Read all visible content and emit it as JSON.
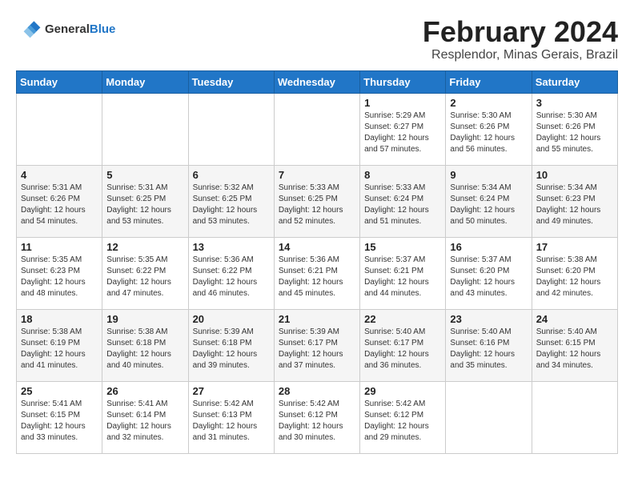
{
  "header": {
    "logo_general": "General",
    "logo_blue": "Blue",
    "month_year": "February 2024",
    "location": "Resplendor, Minas Gerais, Brazil"
  },
  "days_of_week": [
    "Sunday",
    "Monday",
    "Tuesday",
    "Wednesday",
    "Thursday",
    "Friday",
    "Saturday"
  ],
  "weeks": [
    [
      {
        "day": "",
        "info": ""
      },
      {
        "day": "",
        "info": ""
      },
      {
        "day": "",
        "info": ""
      },
      {
        "day": "",
        "info": ""
      },
      {
        "day": "1",
        "info": "Sunrise: 5:29 AM\nSunset: 6:27 PM\nDaylight: 12 hours\nand 57 minutes."
      },
      {
        "day": "2",
        "info": "Sunrise: 5:30 AM\nSunset: 6:26 PM\nDaylight: 12 hours\nand 56 minutes."
      },
      {
        "day": "3",
        "info": "Sunrise: 5:30 AM\nSunset: 6:26 PM\nDaylight: 12 hours\nand 55 minutes."
      }
    ],
    [
      {
        "day": "4",
        "info": "Sunrise: 5:31 AM\nSunset: 6:26 PM\nDaylight: 12 hours\nand 54 minutes."
      },
      {
        "day": "5",
        "info": "Sunrise: 5:31 AM\nSunset: 6:25 PM\nDaylight: 12 hours\nand 53 minutes."
      },
      {
        "day": "6",
        "info": "Sunrise: 5:32 AM\nSunset: 6:25 PM\nDaylight: 12 hours\nand 53 minutes."
      },
      {
        "day": "7",
        "info": "Sunrise: 5:33 AM\nSunset: 6:25 PM\nDaylight: 12 hours\nand 52 minutes."
      },
      {
        "day": "8",
        "info": "Sunrise: 5:33 AM\nSunset: 6:24 PM\nDaylight: 12 hours\nand 51 minutes."
      },
      {
        "day": "9",
        "info": "Sunrise: 5:34 AM\nSunset: 6:24 PM\nDaylight: 12 hours\nand 50 minutes."
      },
      {
        "day": "10",
        "info": "Sunrise: 5:34 AM\nSunset: 6:23 PM\nDaylight: 12 hours\nand 49 minutes."
      }
    ],
    [
      {
        "day": "11",
        "info": "Sunrise: 5:35 AM\nSunset: 6:23 PM\nDaylight: 12 hours\nand 48 minutes."
      },
      {
        "day": "12",
        "info": "Sunrise: 5:35 AM\nSunset: 6:22 PM\nDaylight: 12 hours\nand 47 minutes."
      },
      {
        "day": "13",
        "info": "Sunrise: 5:36 AM\nSunset: 6:22 PM\nDaylight: 12 hours\nand 46 minutes."
      },
      {
        "day": "14",
        "info": "Sunrise: 5:36 AM\nSunset: 6:21 PM\nDaylight: 12 hours\nand 45 minutes."
      },
      {
        "day": "15",
        "info": "Sunrise: 5:37 AM\nSunset: 6:21 PM\nDaylight: 12 hours\nand 44 minutes."
      },
      {
        "day": "16",
        "info": "Sunrise: 5:37 AM\nSunset: 6:20 PM\nDaylight: 12 hours\nand 43 minutes."
      },
      {
        "day": "17",
        "info": "Sunrise: 5:38 AM\nSunset: 6:20 PM\nDaylight: 12 hours\nand 42 minutes."
      }
    ],
    [
      {
        "day": "18",
        "info": "Sunrise: 5:38 AM\nSunset: 6:19 PM\nDaylight: 12 hours\nand 41 minutes."
      },
      {
        "day": "19",
        "info": "Sunrise: 5:38 AM\nSunset: 6:18 PM\nDaylight: 12 hours\nand 40 minutes."
      },
      {
        "day": "20",
        "info": "Sunrise: 5:39 AM\nSunset: 6:18 PM\nDaylight: 12 hours\nand 39 minutes."
      },
      {
        "day": "21",
        "info": "Sunrise: 5:39 AM\nSunset: 6:17 PM\nDaylight: 12 hours\nand 37 minutes."
      },
      {
        "day": "22",
        "info": "Sunrise: 5:40 AM\nSunset: 6:17 PM\nDaylight: 12 hours\nand 36 minutes."
      },
      {
        "day": "23",
        "info": "Sunrise: 5:40 AM\nSunset: 6:16 PM\nDaylight: 12 hours\nand 35 minutes."
      },
      {
        "day": "24",
        "info": "Sunrise: 5:40 AM\nSunset: 6:15 PM\nDaylight: 12 hours\nand 34 minutes."
      }
    ],
    [
      {
        "day": "25",
        "info": "Sunrise: 5:41 AM\nSunset: 6:15 PM\nDaylight: 12 hours\nand 33 minutes."
      },
      {
        "day": "26",
        "info": "Sunrise: 5:41 AM\nSunset: 6:14 PM\nDaylight: 12 hours\nand 32 minutes."
      },
      {
        "day": "27",
        "info": "Sunrise: 5:42 AM\nSunset: 6:13 PM\nDaylight: 12 hours\nand 31 minutes."
      },
      {
        "day": "28",
        "info": "Sunrise: 5:42 AM\nSunset: 6:12 PM\nDaylight: 12 hours\nand 30 minutes."
      },
      {
        "day": "29",
        "info": "Sunrise: 5:42 AM\nSunset: 6:12 PM\nDaylight: 12 hours\nand 29 minutes."
      },
      {
        "day": "",
        "info": ""
      },
      {
        "day": "",
        "info": ""
      }
    ]
  ]
}
